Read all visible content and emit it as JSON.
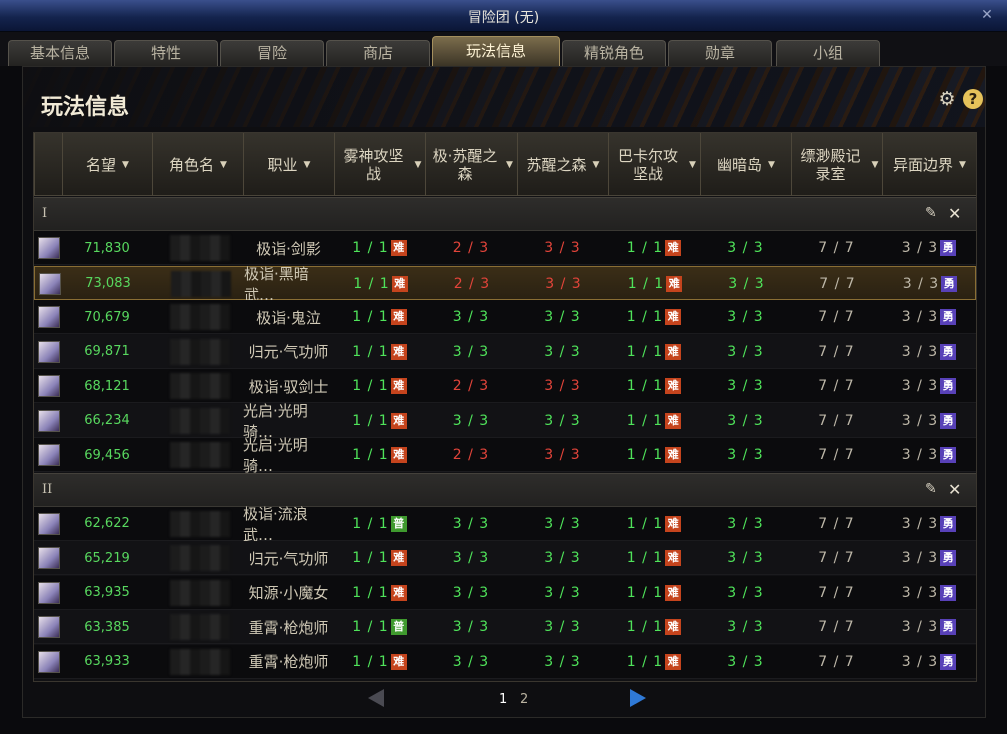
{
  "window": {
    "title": "冒险团 (无)",
    "close_glyph": "✕"
  },
  "tabs": [
    {
      "label": "基本信息",
      "active": false
    },
    {
      "label": "特性",
      "active": false
    },
    {
      "label": "冒险",
      "active": false
    },
    {
      "label": "商店",
      "active": false
    },
    {
      "label": "玩法信息",
      "active": true
    },
    {
      "label": "精锐角色",
      "active": false
    },
    {
      "label": "勋章",
      "active": false
    },
    {
      "label": "小组",
      "active": false
    }
  ],
  "panel": {
    "title": "玩法信息",
    "gear_icon": "gear-icon",
    "help_label": "?"
  },
  "columns": [
    "",
    "名望",
    "角色名",
    "职业",
    "雾神攻坚战",
    "极·苏醒之森",
    "苏醒之森",
    "巴卡尔攻坚战",
    "幽暗岛",
    "缥渺殿记录室",
    "异面边界"
  ],
  "badges": {
    "nan": "难",
    "pu": "普",
    "yong": "勇"
  },
  "colors": {
    "green": "#4fe35a",
    "red": "#e2443a",
    "badge_hard": "#c5441d",
    "badge_normal": "#3f9a2e",
    "badge_brave": "#5841b8"
  },
  "groups": [
    {
      "name": "I",
      "rows": [
        {
          "fame": "71,830",
          "job": "极诣·剑影",
          "c1": "1 / 1",
          "c1b": "nan",
          "c2": "2 / 3",
          "c2c": "r",
          "c3": "3 / 3",
          "c3c": "r",
          "c4": "1 / 1",
          "c4b": "nan",
          "c5": "3 / 3",
          "c6": "7 / 7",
          "c7": "3 / 3"
        },
        {
          "fame": "73,083",
          "job": "极诣·黑暗武…",
          "c1": "1 / 1",
          "c1b": "nan",
          "c2": "2 / 3",
          "c2c": "r",
          "c3": "3 / 3",
          "c3c": "r",
          "c4": "1 / 1",
          "c4b": "nan",
          "c5": "3 / 3",
          "c6": "7 / 7",
          "c7": "3 / 3",
          "selected": true
        },
        {
          "fame": "70,679",
          "job": "极诣·鬼泣",
          "c1": "1 / 1",
          "c1b": "nan",
          "c2": "3 / 3",
          "c2c": "g",
          "c3": "3 / 3",
          "c3c": "g",
          "c4": "1 / 1",
          "c4b": "nan",
          "c5": "3 / 3",
          "c6": "7 / 7",
          "c7": "3 / 3"
        },
        {
          "fame": "69,871",
          "job": "归元·气功师",
          "c1": "1 / 1",
          "c1b": "nan",
          "c2": "3 / 3",
          "c2c": "g",
          "c3": "3 / 3",
          "c3c": "g",
          "c4": "1 / 1",
          "c4b": "nan",
          "c5": "3 / 3",
          "c6": "7 / 7",
          "c7": "3 / 3"
        },
        {
          "fame": "68,121",
          "job": "极诣·驭剑士",
          "c1": "1 / 1",
          "c1b": "nan",
          "c2": "2 / 3",
          "c2c": "r",
          "c3": "3 / 3",
          "c3c": "r",
          "c4": "1 / 1",
          "c4b": "nan",
          "c5": "3 / 3",
          "c6": "7 / 7",
          "c7": "3 / 3"
        },
        {
          "fame": "66,234",
          "job": "光启·光明骑…",
          "c1": "1 / 1",
          "c1b": "nan",
          "c2": "3 / 3",
          "c2c": "g",
          "c3": "3 / 3",
          "c3c": "g",
          "c4": "1 / 1",
          "c4b": "nan",
          "c5": "3 / 3",
          "c6": "7 / 7",
          "c7": "3 / 3"
        },
        {
          "fame": "69,456",
          "job": "光启·光明骑…",
          "c1": "1 / 1",
          "c1b": "nan",
          "c2": "2 / 3",
          "c2c": "r",
          "c3": "3 / 3",
          "c3c": "r",
          "c4": "1 / 1",
          "c4b": "nan",
          "c5": "3 / 3",
          "c6": "7 / 7",
          "c7": "3 / 3"
        }
      ]
    },
    {
      "name": "II",
      "rows": [
        {
          "fame": "62,622",
          "job": "极诣·流浪武…",
          "c1": "1 / 1",
          "c1b": "pu",
          "c2": "3 / 3",
          "c2c": "g",
          "c3": "3 / 3",
          "c3c": "g",
          "c4": "1 / 1",
          "c4b": "nan",
          "c5": "3 / 3",
          "c6": "7 / 7",
          "c7": "3 / 3"
        },
        {
          "fame": "65,219",
          "job": "归元·气功师",
          "c1": "1 / 1",
          "c1b": "nan",
          "c2": "3 / 3",
          "c2c": "g",
          "c3": "3 / 3",
          "c3c": "g",
          "c4": "1 / 1",
          "c4b": "nan",
          "c5": "3 / 3",
          "c6": "7 / 7",
          "c7": "3 / 3"
        },
        {
          "fame": "63,935",
          "job": "知源·小魔女",
          "c1": "1 / 1",
          "c1b": "nan",
          "c2": "3 / 3",
          "c2c": "g",
          "c3": "3 / 3",
          "c3c": "g",
          "c4": "1 / 1",
          "c4b": "nan",
          "c5": "3 / 3",
          "c6": "7 / 7",
          "c7": "3 / 3"
        },
        {
          "fame": "63,385",
          "job": "重霄·枪炮师",
          "c1": "1 / 1",
          "c1b": "pu",
          "c2": "3 / 3",
          "c2c": "g",
          "c3": "3 / 3",
          "c3c": "g",
          "c4": "1 / 1",
          "c4b": "nan",
          "c5": "3 / 3",
          "c6": "7 / 7",
          "c7": "3 / 3"
        },
        {
          "fame": "63,933",
          "job": "重霄·枪炮师",
          "c1": "1 / 1",
          "c1b": "nan",
          "c2": "3 / 3",
          "c2c": "g",
          "c3": "3 / 3",
          "c3c": "g",
          "c4": "1 / 1",
          "c4b": "nan",
          "c5": "3 / 3",
          "c6": "7 / 7",
          "c7": "3 / 3"
        }
      ]
    }
  ],
  "pager": {
    "current": "1",
    "other": "2"
  }
}
